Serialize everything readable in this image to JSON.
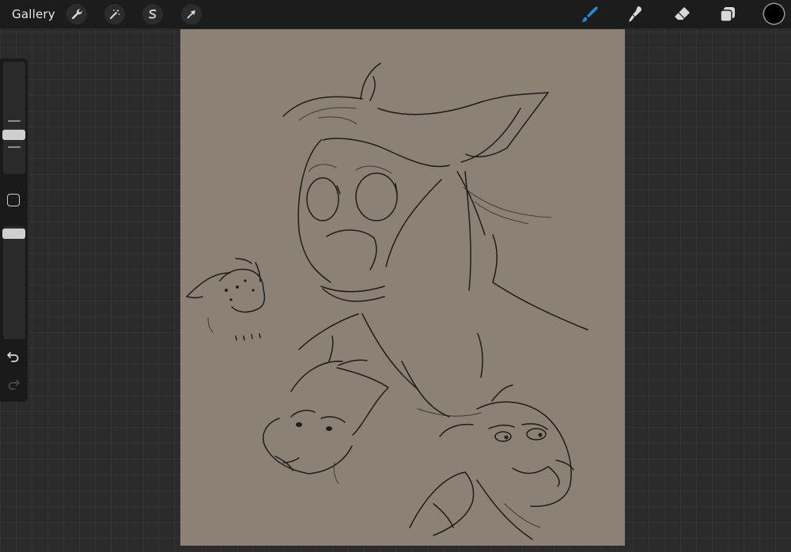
{
  "app": {
    "gallery_label": "Gallery"
  },
  "toolbar": {
    "left_tools": [
      {
        "name": "actions",
        "icon": "wrench-icon"
      },
      {
        "name": "adjustments",
        "icon": "magic-wand-icon"
      },
      {
        "name": "selection",
        "icon": "selection-s-icon"
      },
      {
        "name": "transform",
        "icon": "arrow-cursor-icon"
      }
    ],
    "right_tools": [
      {
        "name": "brush",
        "icon": "brush-icon",
        "active": true
      },
      {
        "name": "smudge",
        "icon": "smudge-icon",
        "active": false
      },
      {
        "name": "eraser",
        "icon": "eraser-icon",
        "active": false
      },
      {
        "name": "layers",
        "icon": "layers-icon",
        "active": false
      }
    ],
    "current_color": "#000000"
  },
  "sidebar": {
    "brush_size": {
      "icon": "brush-size-slider"
    },
    "modify": {
      "icon": "square-modify-icon"
    },
    "opacity": {
      "icon": "opacity-slider"
    },
    "undo": {
      "icon": "undo-icon"
    },
    "redo": {
      "icon": "redo-icon",
      "enabled": false
    }
  },
  "colors": {
    "accent": "#1e88e5",
    "canvas_bg": "#8b8275",
    "toolbar_bg": "#1c1c1d",
    "workspace_bg": "#2b2b2c"
  }
}
